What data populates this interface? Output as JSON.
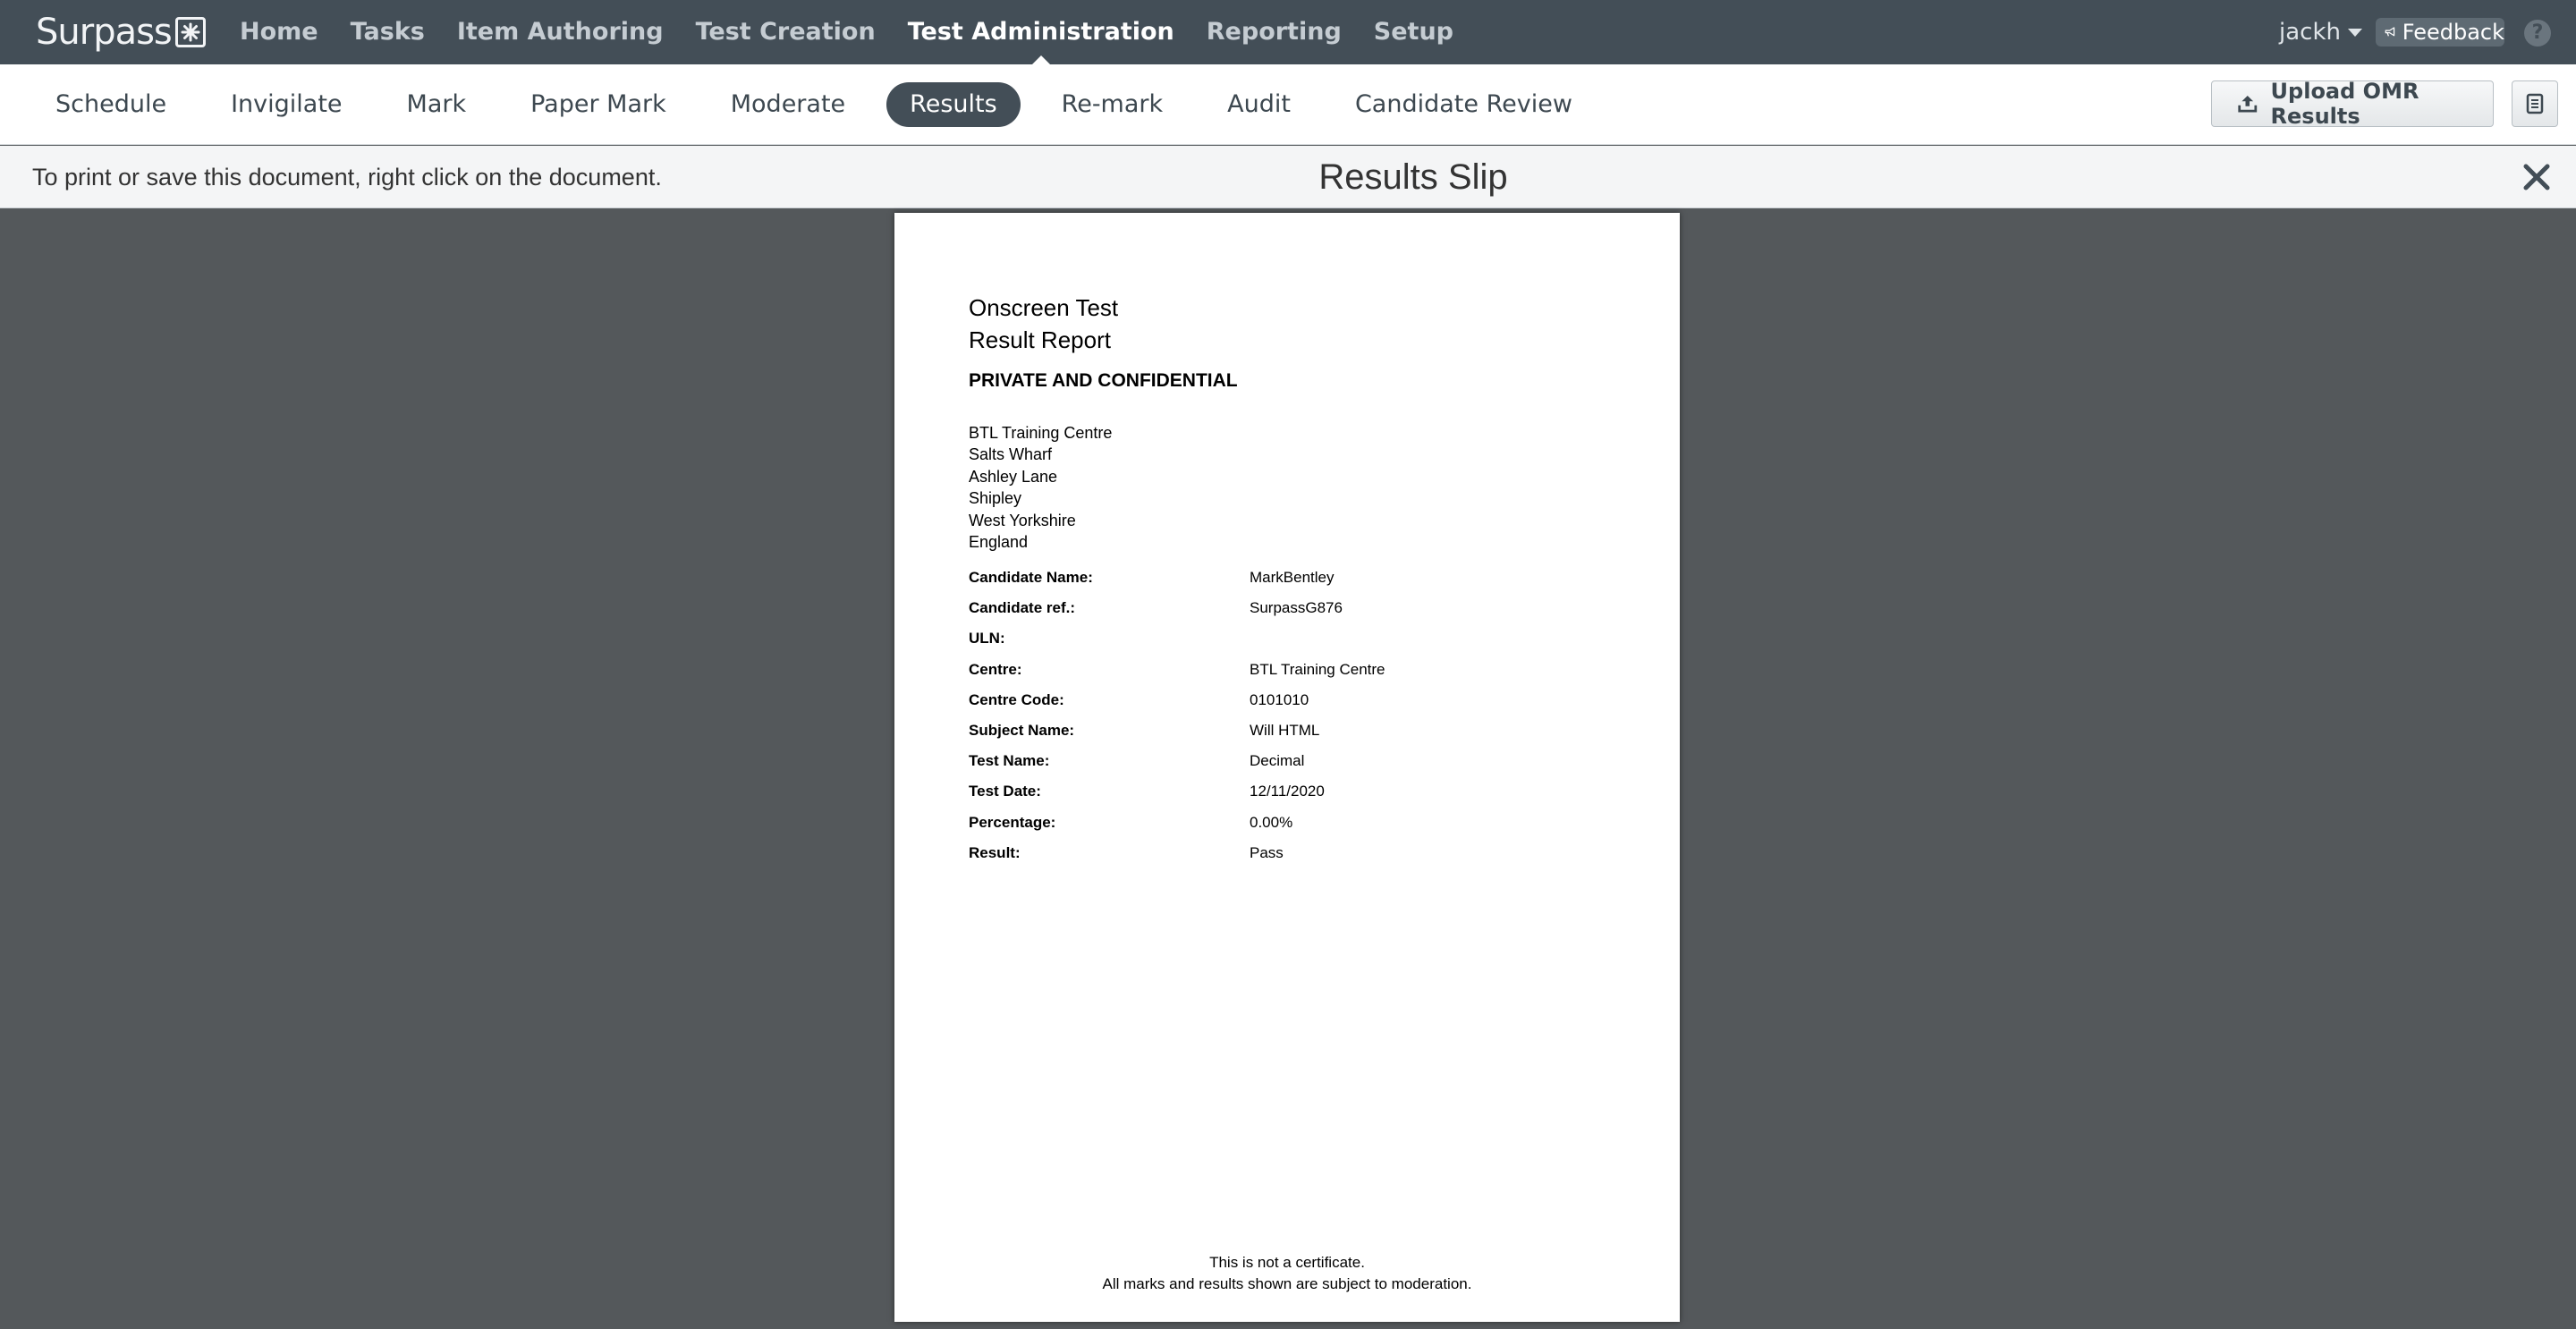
{
  "app": {
    "logo_text": "Surpass",
    "main_nav": [
      "Home",
      "Tasks",
      "Item Authoring",
      "Test Creation",
      "Test Administration",
      "Reporting",
      "Setup"
    ],
    "active_main": "Test Administration",
    "user": "jackh",
    "feedback_label": "Feedback",
    "help_label": "?"
  },
  "sub_nav": {
    "items": [
      "Schedule",
      "Invigilate",
      "Mark",
      "Paper Mark",
      "Moderate",
      "Results",
      "Re-mark",
      "Audit",
      "Candidate Review"
    ],
    "active": "Results",
    "upload_label": "Upload OMR Results"
  },
  "doc_bar": {
    "hint": "To print or save this document, right click on the document.",
    "title": "Results Slip"
  },
  "report": {
    "title_line1": "Onscreen Test",
    "title_line2": "Result Report",
    "confidential": "PRIVATE AND CONFIDENTIAL",
    "address": [
      "BTL Training Centre",
      "Salts Wharf",
      "Ashley Lane",
      "Shipley",
      "West Yorkshire",
      "England"
    ],
    "fields": [
      {
        "label": "Candidate Name:",
        "value": "MarkBentley"
      },
      {
        "label": "Candidate ref.:",
        "value": "SurpassG876"
      },
      {
        "label": "ULN:",
        "value": ""
      },
      {
        "label": "Centre:",
        "value": "BTL Training Centre"
      },
      {
        "label": "Centre Code:",
        "value": "0101010"
      },
      {
        "label": "Subject Name:",
        "value": "Will HTML"
      },
      {
        "label": "Test Name:",
        "value": "Decimal"
      },
      {
        "label": "Test Date:",
        "value": "12/11/2020"
      },
      {
        "label": "Percentage:",
        "value": "0.00%"
      },
      {
        "label": "Result:",
        "value": "Pass"
      }
    ],
    "footer_line1": "This is not a certificate.",
    "footer_line2": "All marks and results shown are subject to moderation."
  },
  "icons": {
    "logo": "snowflake-icon",
    "feedback": "megaphone-icon",
    "upload": "upload-icon",
    "doc_button": "document-icon",
    "close": "close-icon"
  },
  "colors": {
    "topbar": "#434e57",
    "active_pill": "#434e57",
    "viewer_bg": "#54585b"
  }
}
